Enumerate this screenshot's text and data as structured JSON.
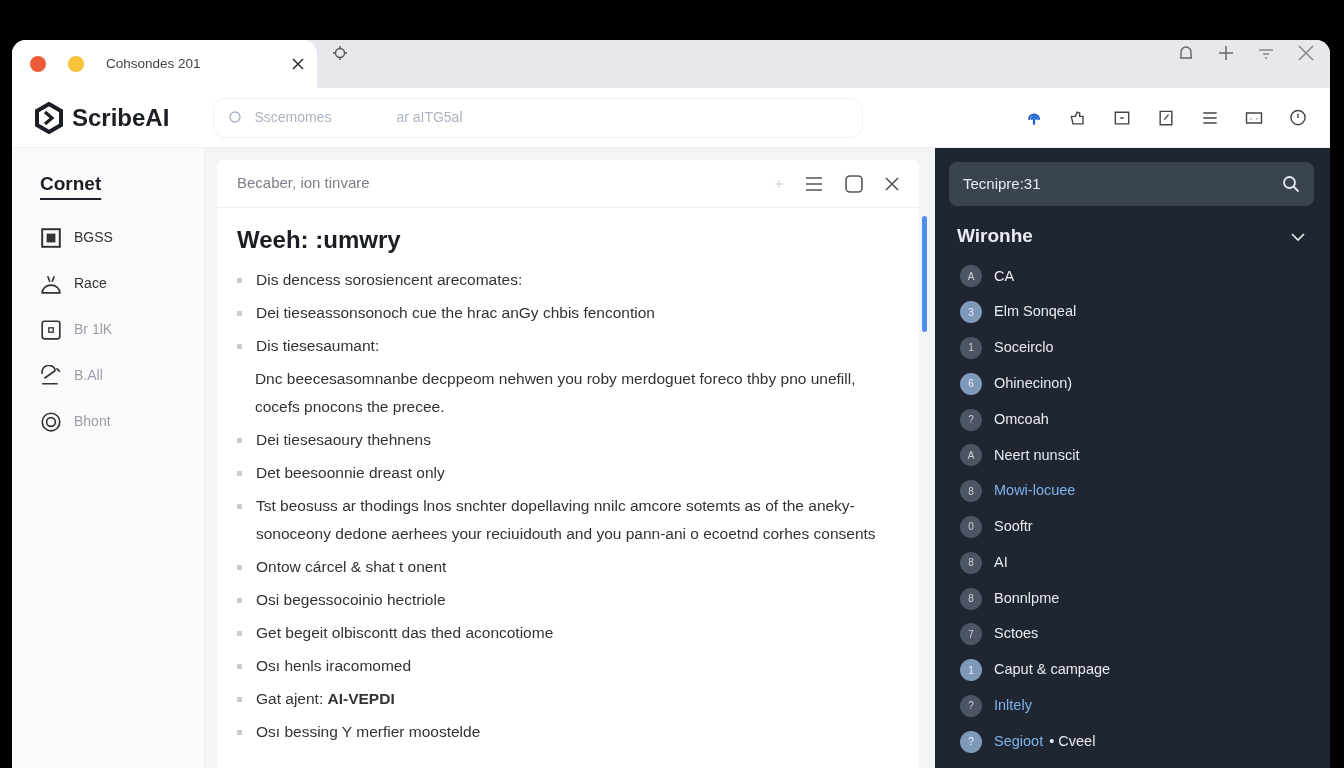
{
  "tab": {
    "title": "Cohsondes 201"
  },
  "app": {
    "name": "ScribeAI"
  },
  "search": {
    "placeholder": "Sscemomes",
    "hint": "ar aITG5al"
  },
  "sidebar": {
    "title": "Cornet",
    "items": [
      {
        "label": "BGSS",
        "muted": false
      },
      {
        "label": "Race",
        "muted": false
      },
      {
        "label": "Br 1lK",
        "muted": true
      },
      {
        "label": "B.All",
        "muted": true
      },
      {
        "label": "Bhont",
        "muted": true
      }
    ]
  },
  "editor": {
    "header": "Becaber, ion tinvare",
    "heading": "Weeh: :umwry",
    "lines": [
      {
        "kind": "bullet",
        "text": "Dis dencess sorosiencent arecomates:"
      },
      {
        "kind": "bullet",
        "text": "Dei tieseassonsonoch cue the hrac anGy chbis fencontion"
      },
      {
        "kind": "bullet",
        "text": "Dis tiesesaumant:"
      },
      {
        "kind": "para",
        "text": "Dnc beecesasomnanbe decppeom nehwen you roby merdoguet foreco thby pno unefill, cocefs pnocons the precee."
      },
      {
        "kind": "bullet",
        "text": "Dei tiesesaoury thehnens"
      },
      {
        "kind": "bullet",
        "text": "Det beesoonnie dreast only"
      },
      {
        "kind": "bullet",
        "text": "Tst beosuss ar thodings lnos snchter dopellaving nnilc amcore sotemts as of the aneky-sonoceony dedone aerhees your reciuidouth and you pann-ani o ecoetnd corhes consents"
      },
      {
        "kind": "bullet",
        "text": "Ontow cárcel & shat t onent"
      },
      {
        "kind": "bullet",
        "text": "Osi begessocoinio hectriole"
      },
      {
        "kind": "bullet",
        "text": "Get begeit olbiscontt das thed aconcotiome"
      },
      {
        "kind": "bullet",
        "text": "Osı henls iracomomed"
      },
      {
        "kind": "bullet",
        "text": "Gat ajent: **AI-VEPDI**"
      },
      {
        "kind": "bullet",
        "text": "Osı bessing Y merfier moostelde"
      }
    ]
  },
  "panel": {
    "search": "Tecnipre:31",
    "section": "Wironhe",
    "expanded": true,
    "items": [
      {
        "badge": "A",
        "label": "CA",
        "tinted": false,
        "link": false
      },
      {
        "badge": "3",
        "label": "Elm Sonqeal",
        "tinted": true,
        "link": false
      },
      {
        "badge": "1",
        "label": "Soceirclo",
        "tinted": false,
        "link": false
      },
      {
        "badge": "6",
        "label": "Ohinecinon)",
        "tinted": true,
        "link": false
      },
      {
        "badge": "?",
        "label": "Omcoah",
        "tinted": false,
        "link": false
      },
      {
        "badge": "A",
        "label": "Neert nunscit",
        "tinted": false,
        "link": false
      },
      {
        "badge": "8",
        "label": "Mowi-locuee",
        "tinted": false,
        "link": true
      },
      {
        "badge": "0",
        "label": "Sooftr",
        "tinted": false,
        "link": false
      },
      {
        "badge": "8",
        "label": "AI",
        "tinted": false,
        "link": false
      },
      {
        "badge": "8",
        "label": "Bonnlpme",
        "tinted": false,
        "link": false
      },
      {
        "badge": "7",
        "label": "Sctoes",
        "tinted": false,
        "link": false
      },
      {
        "badge": "1",
        "label": "Caput & campage",
        "tinted": true,
        "link": false
      },
      {
        "badge": "?",
        "label": "Inltely",
        "tinted": false,
        "link": true
      },
      {
        "badge": "?",
        "label": "Segioot",
        "suffix": "• Cveel",
        "tinted": true,
        "link": true
      }
    ]
  }
}
